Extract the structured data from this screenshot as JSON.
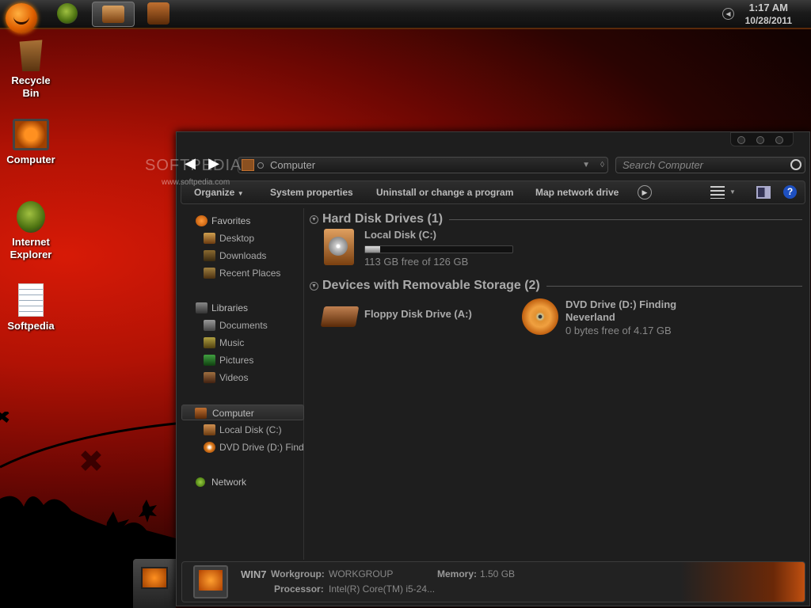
{
  "taskbar": {
    "clock_time": "1:17 AM",
    "clock_date": "10/28/2011"
  },
  "desktop": {
    "icons": [
      {
        "label": "Recycle Bin",
        "icon": "recycle-bin-icon"
      },
      {
        "label": "Computer",
        "icon": "computer-icon"
      },
      {
        "label": "Internet Explorer",
        "icon": "internet-explorer-icon"
      },
      {
        "label": "Softpedia",
        "icon": "document-icon"
      }
    ],
    "watermark": "SOFTPEDIA",
    "watermark_url": "www.softpedia.com"
  },
  "explorer": {
    "address": "Computer",
    "search_placeholder": "Search Computer",
    "toolbar": {
      "organize": "Organize",
      "system_properties": "System properties",
      "uninstall": "Uninstall or change a program",
      "map_drive": "Map network drive"
    },
    "nav": {
      "favorites": "Favorites",
      "desktop": "Desktop",
      "downloads": "Downloads",
      "recent_places": "Recent Places",
      "libraries": "Libraries",
      "documents": "Documents",
      "music": "Music",
      "pictures": "Pictures",
      "videos": "Videos",
      "computer": "Computer",
      "local_disk": "Local Disk (C:)",
      "dvd_drive": "DVD Drive (D:) Finding Neverland",
      "network": "Network"
    },
    "groups": {
      "hdd_title": "Hard Disk Drives (1)",
      "removable_title": "Devices with Removable Storage (2)"
    },
    "drives": {
      "local_name": "Local Disk (C:)",
      "local_free": "113 GB free of 126 GB",
      "local_used_fraction": 0.103,
      "floppy_name": "Floppy Disk Drive (A:)",
      "dvd_name_line1": "DVD Drive (D:) Finding",
      "dvd_name_line2": "Neverland",
      "dvd_free": "0 bytes free of 4.17 GB"
    },
    "details": {
      "computer_name": "WIN7",
      "workgroup_label": "Workgroup:",
      "workgroup_value": "WORKGROUP",
      "memory_label": "Memory:",
      "memory_value": "1.50 GB",
      "processor_label": "Processor:",
      "processor_value": "Intel(R) Core(TM) i5-24..."
    }
  }
}
